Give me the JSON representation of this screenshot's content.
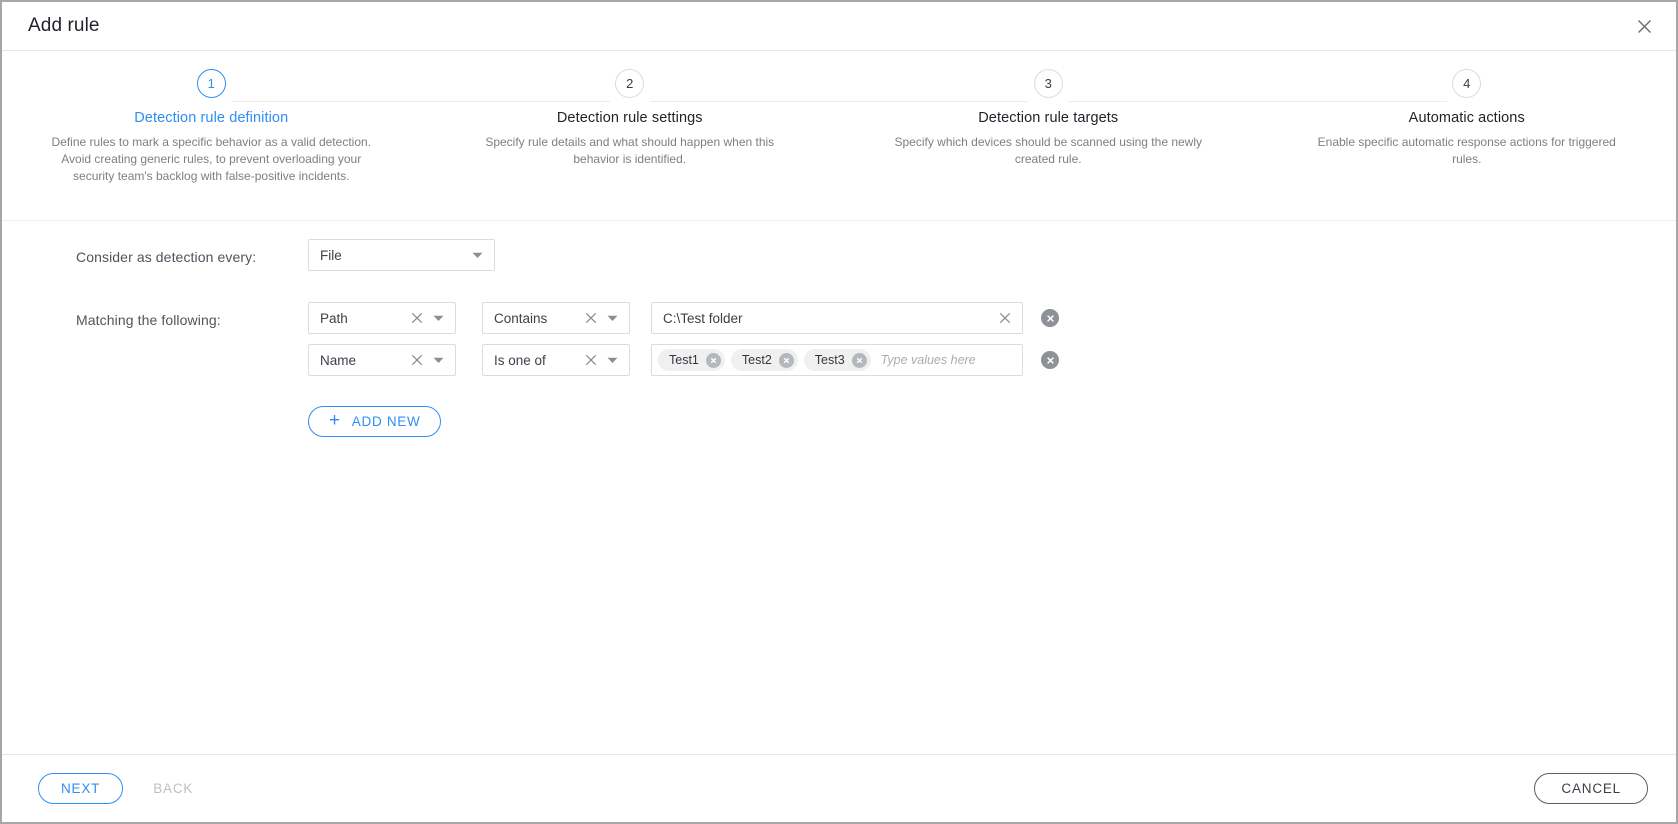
{
  "dialog": {
    "title": "Add rule",
    "close_icon": "close-icon"
  },
  "stepper": {
    "steps": [
      {
        "number": "1",
        "label": "Detection rule definition",
        "description": "Define rules to mark a specific behavior as a valid detection. Avoid creating generic rules, to prevent overloading your security team's backlog with false-positive incidents.",
        "active": true
      },
      {
        "number": "2",
        "label": "Detection rule settings",
        "description": "Specify rule details and what should happen when this behavior is identified.",
        "active": false
      },
      {
        "number": "3",
        "label": "Detection rule targets",
        "description": "Specify which devices should be scanned using the newly created rule.",
        "active": false
      },
      {
        "number": "4",
        "label": "Automatic actions",
        "description": "Enable specific automatic response actions for triggered rules.",
        "active": false
      }
    ]
  },
  "form": {
    "detection": {
      "label": "Consider as detection every:",
      "value": "File"
    },
    "matching": {
      "label": "Matching the following:",
      "rows": [
        {
          "attribute": "Path",
          "operator": "Contains",
          "value": "C:\\Test folder"
        },
        {
          "attribute": "Name",
          "operator": "Is one of",
          "chips": [
            "Test1",
            "Test2",
            "Test3"
          ],
          "placeholder": "Type values here"
        }
      ]
    },
    "add_new_label": "ADD NEW"
  },
  "footer": {
    "next_label": "NEXT",
    "back_label": "BACK",
    "cancel_label": "CANCEL"
  },
  "colors": {
    "accent": "#2f8ef4",
    "text": "#20242a",
    "muted": "#7b7f86",
    "border": "#dcdcdc",
    "chip_bg": "#f0f0f0"
  }
}
